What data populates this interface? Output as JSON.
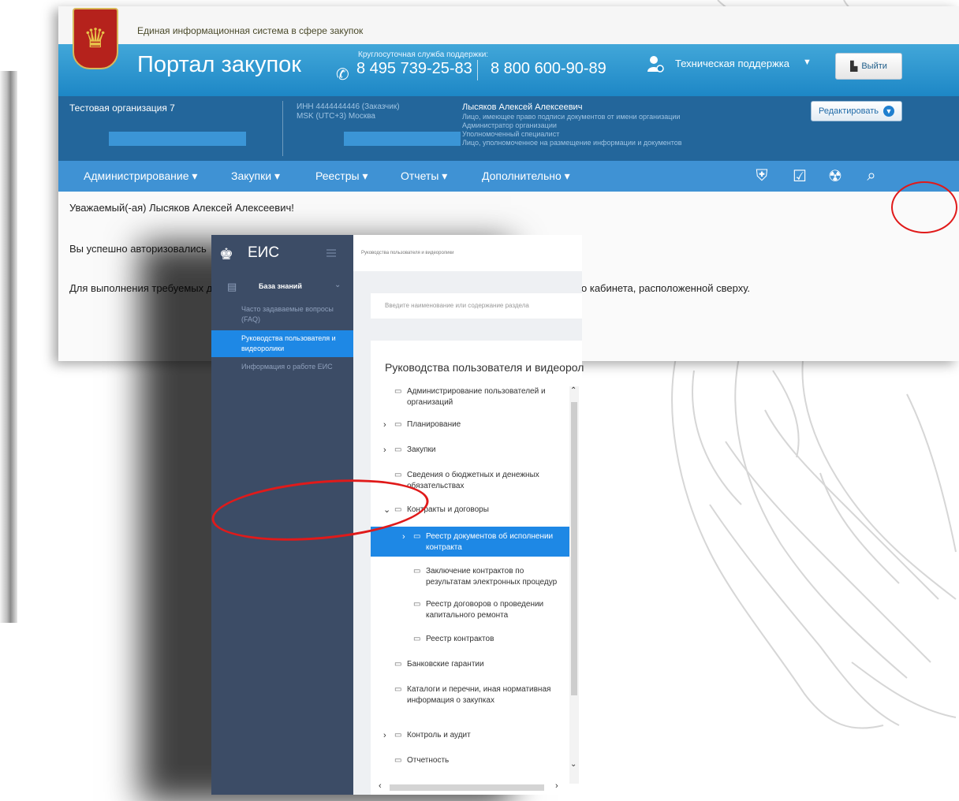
{
  "portal": {
    "system_name": "Единая информационная система в сфере закупок",
    "title": "Портал закупок",
    "hotline_label": "Круглосуточная служба поддержки:",
    "phone_1": "8 495 739-25-83",
    "phone_2": "8 800 600-90-89",
    "support_label": "Техническая поддержка",
    "logout_label": "Выйти",
    "org_name": "Тестовая организация 7",
    "inn": "ИНН 4444444446 (Заказчик)",
    "timezone": "MSK (UTC+3) Москва",
    "user_name": "Лысяков Алексей Алексеевич",
    "roles": [
      "Лицо, имеющее право подписи документов от имени организации",
      "Администратор организации",
      "Уполномоченный специалист",
      "Лицо, уполномоченное на размещение информации и документов"
    ],
    "edit_label": "Редактировать",
    "menu": [
      {
        "label": "Администрирование"
      },
      {
        "label": "Закупки"
      },
      {
        "label": "Реестры"
      },
      {
        "label": "Отчеты"
      },
      {
        "label": "Дополнительно"
      }
    ],
    "menu_icons": [
      "shield-icon",
      "calendar-check-icon",
      "notifications-icon",
      "book-search-icon"
    ],
    "greeting": "Уважаемый(-ая) Лысяков Алексей Алексеевич!",
    "auth_text": "Вы успешно авторизовались",
    "perform_text": "Для выполнения требуемых д",
    "perform_tail": "о кабинета, расположенной сверху."
  },
  "eis": {
    "logo": "ЕИС",
    "breadcrumb": "Руководства пользователя и видеоролики",
    "kb_label": "База знаний",
    "sidebar": [
      {
        "label": "Часто задаваемые вопросы (FAQ)"
      },
      {
        "label": "Руководства пользователя и видеоролики"
      },
      {
        "label": "Информация о работе ЕИС"
      }
    ],
    "search_placeholder": "Введите наименование или содержание раздела",
    "card_title": "Руководства пользователя и видеорол",
    "tree": [
      {
        "label": "Администрирование пользователей и организаций",
        "level": 0,
        "arrow": ""
      },
      {
        "label": "Планирование",
        "level": 0,
        "arrow": ">"
      },
      {
        "label": "Закупки",
        "level": 0,
        "arrow": ">"
      },
      {
        "label": "Сведения о бюджетных и денежных обязательствах",
        "level": 0,
        "arrow": ""
      },
      {
        "label": "Контракты и договоры",
        "level": 0,
        "arrow": "v"
      },
      {
        "label": "Реестр документов об исполнении контракта",
        "level": 1,
        "arrow": ">",
        "active": true
      },
      {
        "label": "Заключение контрактов по результатам электронных процедур",
        "level": 1,
        "arrow": ""
      },
      {
        "label": "Реестр договоров о проведении капитального ремонта",
        "level": 1,
        "arrow": ""
      },
      {
        "label": "Реестр контрактов",
        "level": 1,
        "arrow": ""
      },
      {
        "label": "Банковские гарантии",
        "level": 0,
        "arrow": ""
      },
      {
        "label": "Каталоги и перечни, иная нормативная информация о закупках",
        "level": 0,
        "arrow": ""
      },
      {
        "label": "Контроль и аудит",
        "level": 0,
        "arrow": ">"
      },
      {
        "label": "Отчетность",
        "level": 0,
        "arrow": ""
      }
    ]
  },
  "colors": {
    "header_blue": "#1d87c6",
    "org_band": "#23669b",
    "menu_bar": "#3f92d4",
    "eis_sidebar": "#3c4c66",
    "active_blue": "#1e88e5",
    "annotation_red": "#e01a1a"
  }
}
